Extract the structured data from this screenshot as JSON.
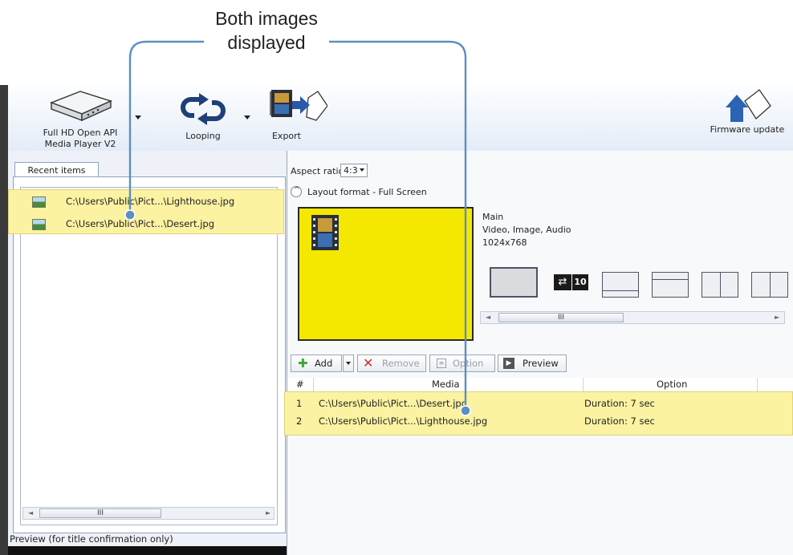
{
  "callout": {
    "line1": "Both images",
    "line2": "displayed"
  },
  "toolbar": {
    "device_line1": "Full HD Open API",
    "device_line2": "Media Player V2",
    "looping_label": "Looping",
    "export_label": "Export",
    "firmware_label": "Firmware update"
  },
  "left_panel": {
    "tab_label": "Recent items",
    "items": [
      {
        "path": "C:\\Users\\Public\\Pict...\\Lighthouse.jpg"
      },
      {
        "path": "C:\\Users\\Public\\Pict...\\Desert.jpg"
      }
    ],
    "scroll_grip": "III",
    "preview_label": "Preview (for title confirmation only)"
  },
  "right_panel": {
    "aspect_label": "Aspect ratio",
    "aspect_value": "4:3",
    "layout_label": "Layout format - Full Screen",
    "zone_name": "Main",
    "zone_types": "Video, Image, Audio",
    "zone_resolution": "1024x768",
    "layout_badge": "10",
    "scroll_grip": "III",
    "buttons": {
      "add": "Add",
      "remove": "Remove",
      "option": "Option",
      "preview": "Preview"
    },
    "grid": {
      "headers": [
        "#",
        "Media",
        "Option"
      ],
      "rows": [
        {
          "num": "1",
          "media": "C:\\Users\\Public\\Pict...\\Desert.jpg",
          "option": "Duration: 7 sec"
        },
        {
          "num": "2",
          "media": "C:\\Users\\Public\\Pict...\\Lighthouse.jpg",
          "option": "Duration: 7 sec"
        }
      ]
    }
  },
  "colors": {
    "highlight": "#fbf2a2",
    "callout_line": "#5b8fc4",
    "layout_yellow": "#f5e800",
    "remove_red": "#d22b2b",
    "add_green": "#3fa535"
  }
}
